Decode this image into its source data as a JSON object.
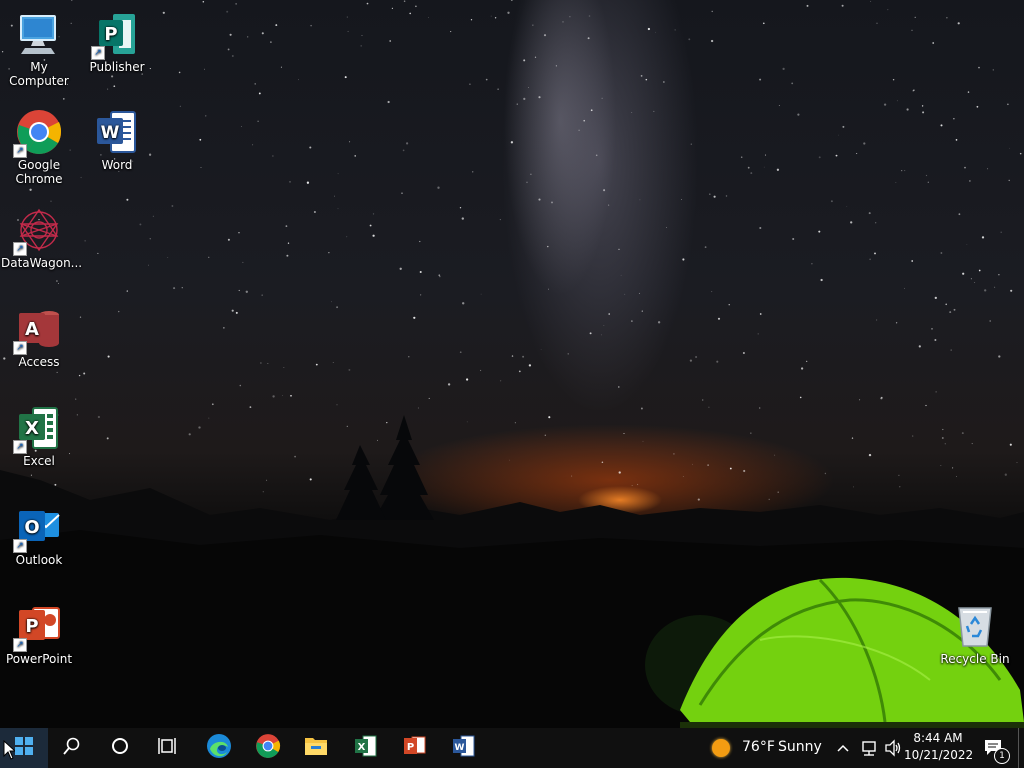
{
  "desktop_icons": [
    {
      "name": "My Computer",
      "icon": "computer-icon"
    },
    {
      "name": "Publisher",
      "icon": "publisher-icon",
      "letter": "P"
    },
    {
      "name": "Google Chrome",
      "icon": "chrome-icon"
    },
    {
      "name": "Word",
      "icon": "word-icon",
      "letter": "W"
    },
    {
      "name": "DataWagon...",
      "icon": "datawagon-icon"
    },
    {
      "name": "Access",
      "icon": "access-icon",
      "letter": "A"
    },
    {
      "name": "Excel",
      "icon": "excel-icon",
      "letter": "X"
    },
    {
      "name": "Outlook",
      "icon": "outlook-icon",
      "letter": "O"
    },
    {
      "name": "PowerPoint",
      "icon": "powerpoint-icon",
      "letter": "P"
    },
    {
      "name": "Recycle Bin",
      "icon": "recycle-bin-icon"
    }
  ],
  "taskbar": {
    "pinned": [
      "start-icon",
      "search-icon",
      "cortana-icon",
      "task-view-icon",
      "edge-icon",
      "chrome-icon",
      "file-explorer-icon",
      "excel-icon",
      "powerpoint-icon",
      "word-icon"
    ],
    "weather": {
      "temp": "76°F",
      "condition": "Sunny",
      "icon": "sun-icon"
    },
    "clock": {
      "time": "8:44 AM",
      "date": "10/21/2022"
    },
    "notifications": {
      "count": "1"
    }
  }
}
